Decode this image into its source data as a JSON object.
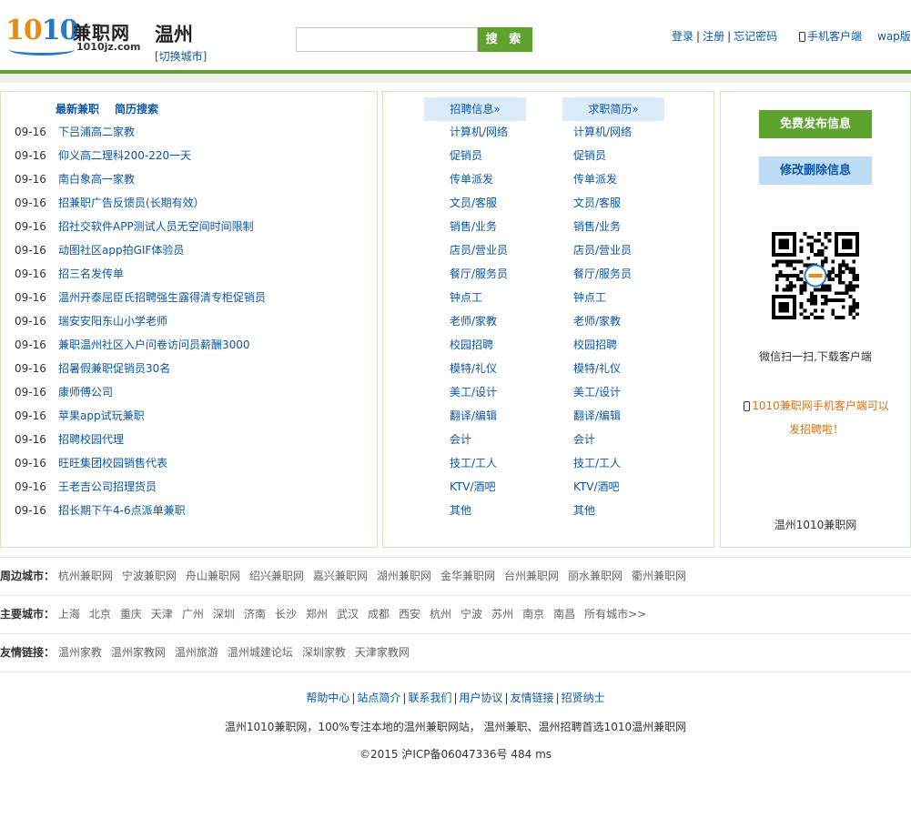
{
  "header": {
    "logo_num": "1010",
    "logo_cn": "兼职网",
    "logo_domain": "1010jz.com",
    "city": "温州",
    "switch_city": "[切换城市]",
    "search_placeholder": "",
    "search_button": "搜 索",
    "login": "登录",
    "register": "注册",
    "forgot": "忘记密码",
    "mobile": "手机客户端",
    "wap": "wap版",
    "sep": "|"
  },
  "left": {
    "tab_latest": "最新兼职",
    "tab_resume": "简历搜索",
    "jobs": [
      {
        "date": "09-16",
        "title": "下吕浦高二家教"
      },
      {
        "date": "09-16",
        "title": "仰义高二理科200-220一天"
      },
      {
        "date": "09-16",
        "title": "南白象高一家教"
      },
      {
        "date": "09-16",
        "title": "招兼职广告反馈员(长期有效）"
      },
      {
        "date": "09-16",
        "title": "招社交软件APP测试人员无空间时间限制"
      },
      {
        "date": "09-16",
        "title": "动图社区app拍GIF体验员"
      },
      {
        "date": "09-16",
        "title": "招三名发传单"
      },
      {
        "date": "09-16",
        "title": "温州开泰屈臣氏招聘强生露得清专柜促销员"
      },
      {
        "date": "09-16",
        "title": "瑞安安阳东山小学老师"
      },
      {
        "date": "09-16",
        "title": "兼职温州社区入户问卷访问员薪酬3000"
      },
      {
        "date": "09-16",
        "title": "招暑假兼职促销员30名"
      },
      {
        "date": "09-16",
        "title": "康师傅公司"
      },
      {
        "date": "09-16",
        "title": "苹果app试玩兼职"
      },
      {
        "date": "09-16",
        "title": "招聘校园代理"
      },
      {
        "date": "09-16",
        "title": "旺旺集团校园销售代表"
      },
      {
        "date": "09-16",
        "title": "王老吉公司招理货员"
      },
      {
        "date": "09-16",
        "title": "招长期下午4-6点派单兼职"
      }
    ]
  },
  "middle": {
    "head_recruit": "招聘信息»",
    "head_resume": "求职简历»",
    "categories": [
      "计算机/网络",
      "促销员",
      "传单派发",
      "文员/客服",
      "销售/业务",
      "店员/营业员",
      "餐厅/服务员",
      "钟点工",
      "老师/家教",
      "校园招聘",
      "模特/礼仪",
      "美工/设计",
      "翻译/编辑",
      "会计",
      "技工/工人",
      "KTV/酒吧",
      "其他"
    ]
  },
  "right": {
    "publish": "免费发布信息",
    "edit": "修改删除信息",
    "qr_caption": "微信扫一扫,下载客户端",
    "promo": "1010兼职网手机客户端可以发招聘啦！",
    "site_name": "温州1010兼职网"
  },
  "links": {
    "nearby_label": "周边城市：",
    "nearby": [
      "杭州兼职网",
      "宁波兼职网",
      "舟山兼职网",
      "绍兴兼职网",
      "嘉兴兼职网",
      "湖州兼职网",
      "金华兼职网",
      "台州兼职网",
      "丽水兼职网",
      "衢州兼职网"
    ],
    "major_label": "主要城市：",
    "major": [
      "上海",
      "北京",
      "重庆",
      "天津",
      "广州",
      "深圳",
      "济南",
      "长沙",
      "郑州",
      "武汉",
      "成都",
      "西安",
      "杭州",
      "宁波",
      "苏州",
      "南京",
      "南昌",
      "所有城市>>"
    ],
    "friend_label": "友情链接：",
    "friends": [
      "温州家教",
      "温州家教网",
      "温州旅游",
      "温州城建论坛",
      "深圳家教",
      "天津家教网"
    ]
  },
  "footer": {
    "links": [
      "帮助中心",
      "站点简介",
      "联系我们",
      "用户协议",
      "友情链接",
      "招贤纳士"
    ],
    "desc": "温州1010兼职网，100%专注本地的温州兼职网站， 温州兼职、温州招聘首选1010温州兼职网",
    "copy": "©2015 沪ICP备06047336号    484 ms"
  },
  "colors": {
    "brand_green": "#5ea22e",
    "link_blue": "#0b57a4",
    "promo_orange": "#e07010"
  }
}
